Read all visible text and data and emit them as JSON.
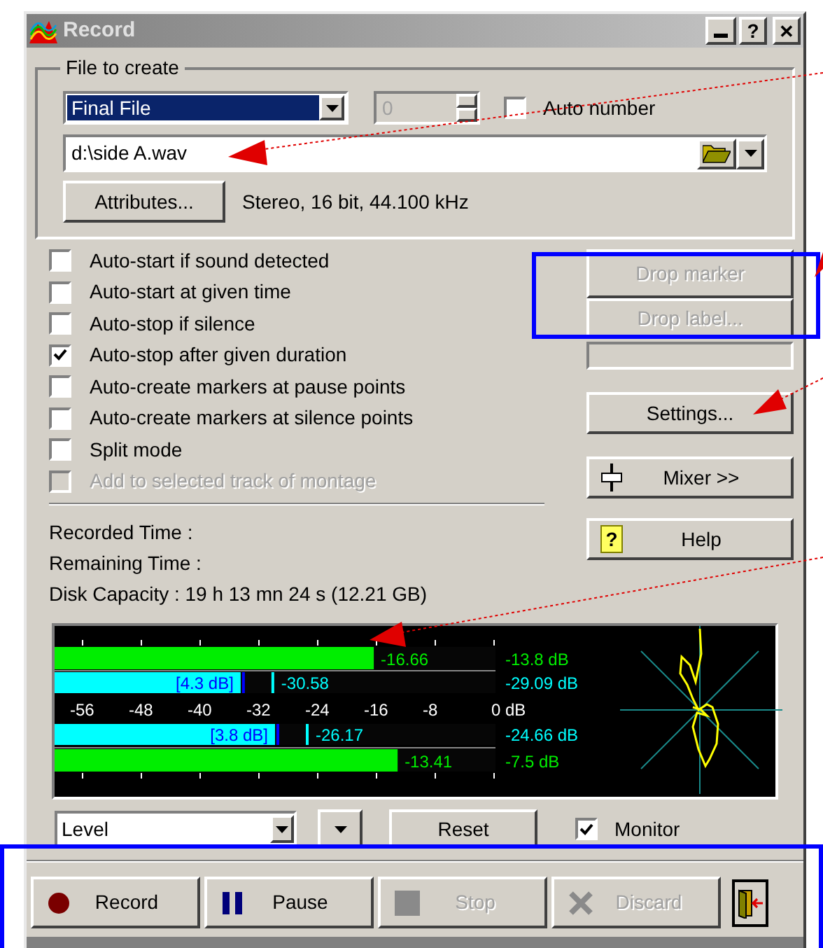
{
  "window": {
    "title": "Record",
    "buttons": [
      {
        "kind": "minimize"
      },
      {
        "kind": "help",
        "label": "?"
      },
      {
        "kind": "close",
        "label": "✕"
      }
    ]
  },
  "file_group": {
    "title": "File to create",
    "type_select": {
      "value": "Final File"
    },
    "counter": {
      "value": "0",
      "disabled": true
    },
    "auto_number": {
      "label": "Auto number",
      "checked": false
    },
    "path": {
      "value": "d:\\side A.wav"
    },
    "attributes_button": "Attributes...",
    "format": "Stereo, 16 bit, 44.100 kHz"
  },
  "options": [
    {
      "label": "Auto-start if sound detected",
      "checked": false,
      "disabled": false
    },
    {
      "label": "Auto-start at given time",
      "checked": false,
      "disabled": false
    },
    {
      "label": "Auto-stop if silence",
      "checked": false,
      "disabled": false
    },
    {
      "label": "Auto-stop after given duration",
      "checked": true,
      "disabled": false
    },
    {
      "label": "Auto-create markers at pause points",
      "checked": false,
      "disabled": false
    },
    {
      "label": "Auto-create markers at silence points",
      "checked": false,
      "disabled": false
    },
    {
      "label": "Split mode",
      "checked": false,
      "disabled": false
    },
    {
      "label": "Add to selected track of montage",
      "checked": false,
      "disabled": true
    }
  ],
  "marker_buttons": [
    {
      "label": "Drop marker",
      "disabled": true
    },
    {
      "label": "Drop label...",
      "disabled": true
    }
  ],
  "actions": [
    {
      "kind": "settings",
      "label": "Settings..."
    },
    {
      "kind": "mixer",
      "label": "Mixer >>"
    },
    {
      "kind": "help",
      "label": "Help",
      "icon": "?"
    }
  ],
  "info": [
    "Recorded Time :",
    "Remaining Time :",
    "Disk Capacity : 19 h 13 mn 24 s (12.21 GB)"
  ],
  "meters": {
    "rows": [
      {
        "kind": "peak",
        "level": 0.724,
        "reading": "-16.66",
        "value": "-13.8 dB"
      },
      {
        "kind": "rms",
        "level": 0.422,
        "hold": "[4.3 dB]",
        "reading": "-30.58",
        "value": "-29.09 dB"
      },
      {
        "kind": "scale",
        "ticks": [
          "-56",
          "-48",
          "-40",
          "-32",
          "-24",
          "-16",
          "-8",
          "0 dB"
        ]
      },
      {
        "kind": "rms",
        "level": 0.5,
        "hold": "[3.8 dB]",
        "reading": "-26.17",
        "value": "-24.66 dB"
      },
      {
        "kind": "peak",
        "level": 0.778,
        "reading": "-13.41",
        "value": "-7.5 dB"
      }
    ]
  },
  "view_select": {
    "value": "Level"
  },
  "reset_button": "Reset",
  "monitor": {
    "label": "Monitor",
    "checked": true
  },
  "transport": [
    {
      "kind": "record",
      "label": "Record",
      "disabled": false
    },
    {
      "kind": "pause",
      "label": "Pause",
      "disabled": false
    },
    {
      "kind": "stop",
      "label": "Stop",
      "disabled": true
    },
    {
      "kind": "discard",
      "label": "Discard",
      "disabled": true
    },
    {
      "kind": "exit"
    }
  ]
}
